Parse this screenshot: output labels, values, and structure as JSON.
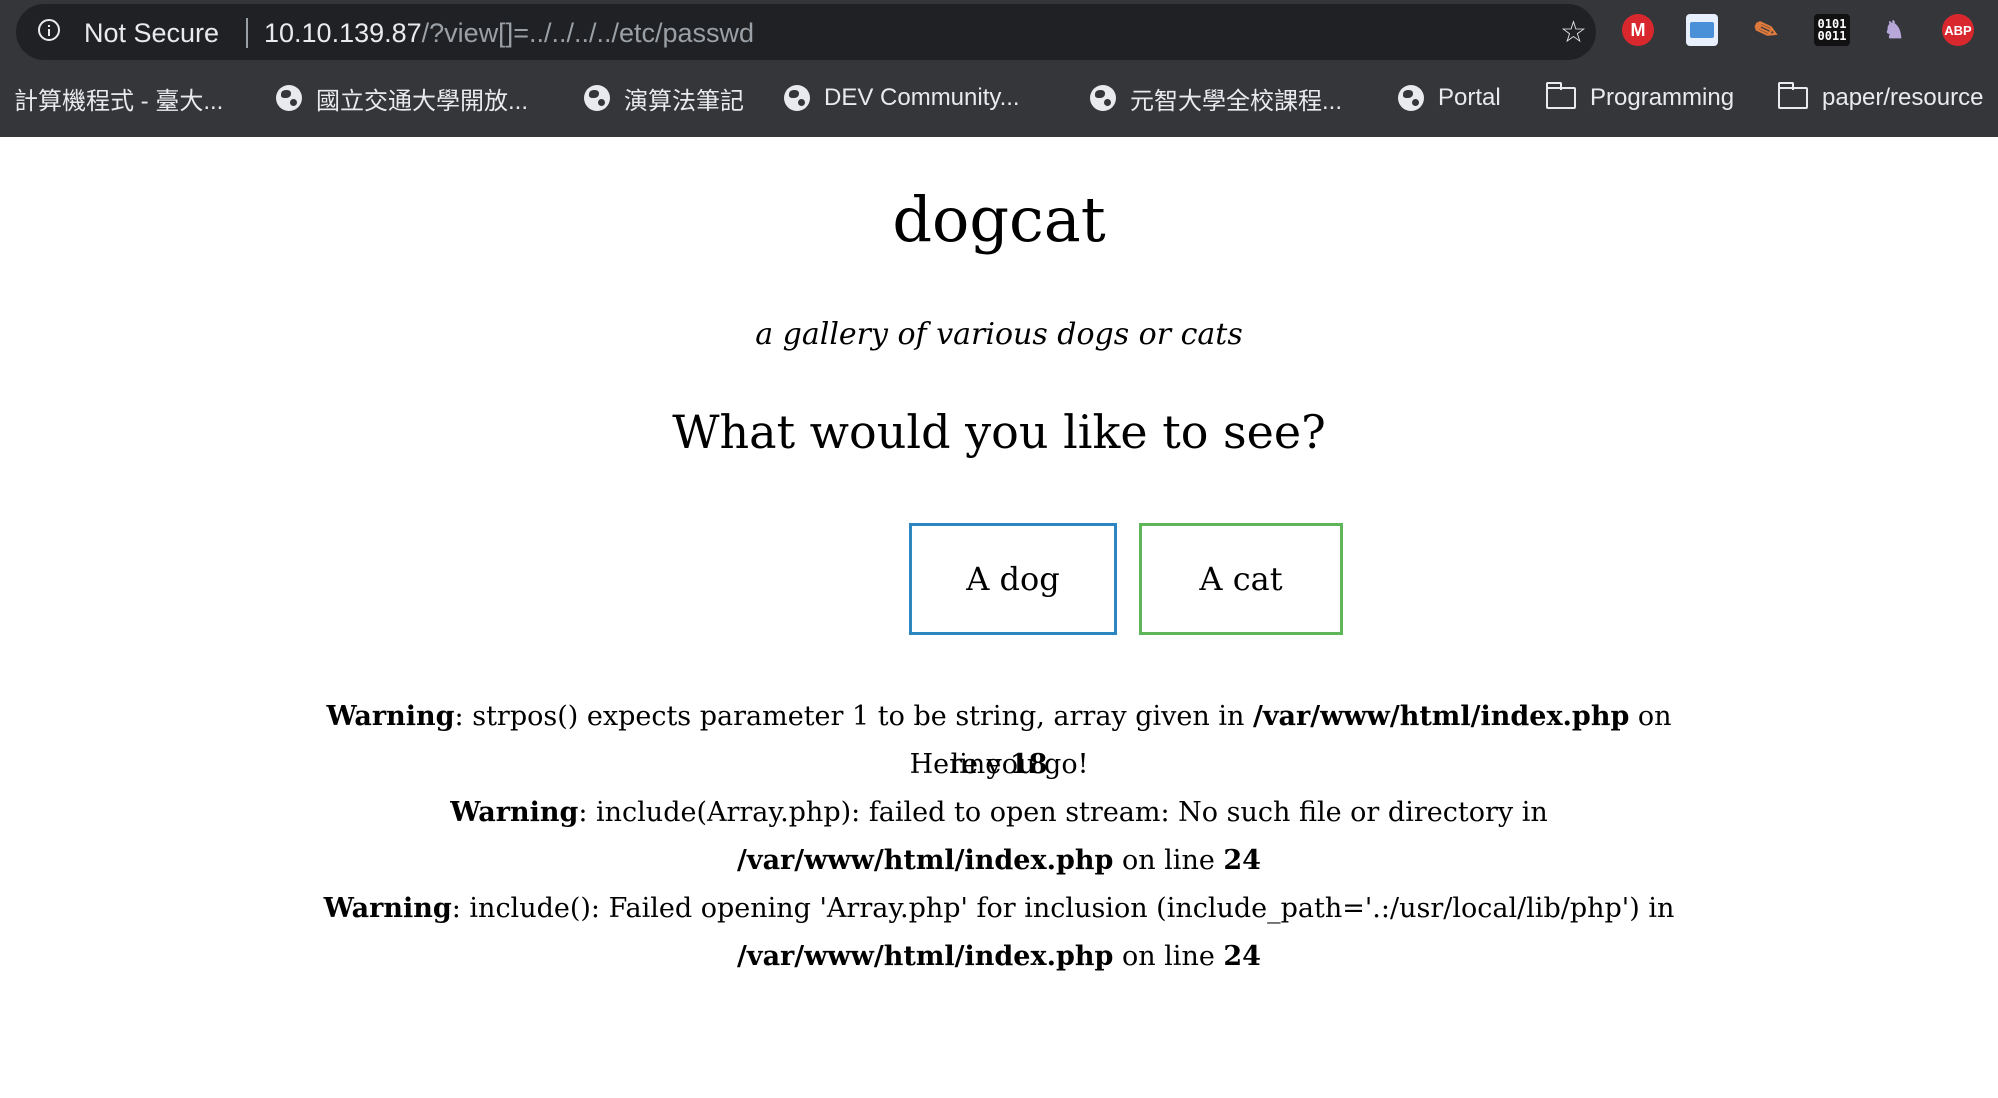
{
  "browser": {
    "security_label": "Not Secure",
    "url_host": "10.10.139.87",
    "url_path": "/?view[]=../../../../etc/passwd",
    "extensions": [
      "mega-icon",
      "window-icon",
      "feather-icon",
      "binary-icon",
      "cat-icon",
      "abp-icon"
    ],
    "ext_labels": {
      "mega": "M",
      "binary": "0101\n0011",
      "abp": "ABP"
    },
    "bookmarks": [
      {
        "label": "計算機程式 - 臺大...",
        "icon": "none"
      },
      {
        "label": "國立交通大學開放...",
        "icon": "globe-icon"
      },
      {
        "label": "演算法筆記",
        "icon": "globe-icon"
      },
      {
        "label": "DEV Community...",
        "icon": "globe-icon"
      },
      {
        "label": "元智大學全校課程...",
        "icon": "globe-icon"
      },
      {
        "label": "Portal",
        "icon": "globe-icon"
      },
      {
        "label": "Programming",
        "icon": "folder-icon"
      },
      {
        "label": "paper/resource",
        "icon": "folder-icon"
      }
    ]
  },
  "page": {
    "title": "dogcat",
    "subtitle": "a gallery of various dogs or cats",
    "question": "What would you like to see?",
    "buttons": {
      "dog": "A dog",
      "cat": "A cat"
    },
    "messages": {
      "m1_label": "Warning",
      "m1_a": ": strpos() expects parameter 1 to be string, array given in ",
      "m1_path": "/var/www/html/index.php",
      "m1_b": " on line ",
      "m1_line": "18",
      "m2": "Here you go!",
      "m3_label": "Warning",
      "m3_a": ": include(Array.php): failed to open stream: No such file or directory in ",
      "m3_path": "/var/www/html/index.php",
      "m3_b": " on line ",
      "m3_line": "24",
      "m4_label": "Warning",
      "m4_a": ": include(): Failed opening 'Array.php' for inclusion (include_path='.:/usr/local/lib/php') in ",
      "m4_path": "/var/www/html/index.php",
      "m4_b": " on line ",
      "m4_line": "24"
    }
  },
  "colors": {
    "dog_border": "#2e86c1",
    "cat_border": "#5fb55a",
    "chrome_bg": "#35363a"
  }
}
